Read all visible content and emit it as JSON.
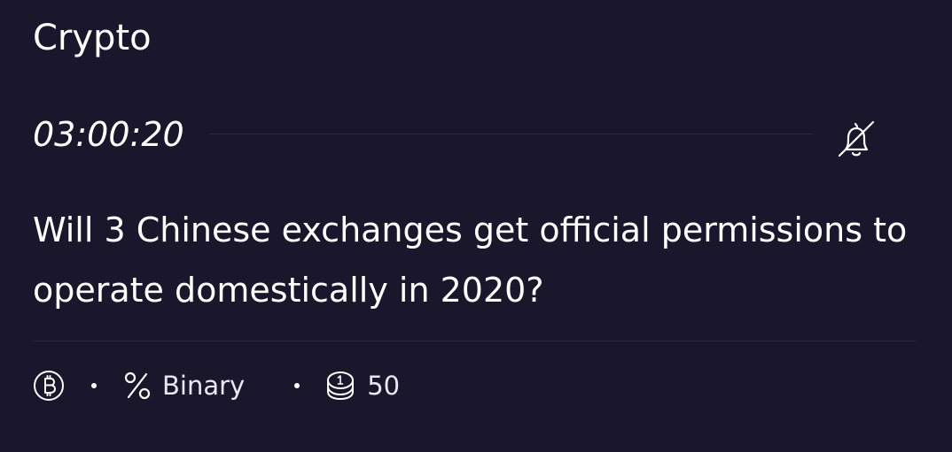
{
  "category": "Crypto",
  "timer": "03:00:20",
  "question": "Will 3 Chinese exchanges get official permissions to operate domestically in 2020?",
  "meta": {
    "type_label": "Binary",
    "points": "50"
  },
  "icons": {
    "bell": "bell-off-icon",
    "currency": "bitcoin-icon",
    "type": "percent-icon",
    "points": "coin-stack-icon"
  },
  "colors": {
    "background": "#1a162b",
    "text": "#ffffff",
    "divider": "#2c2840"
  }
}
